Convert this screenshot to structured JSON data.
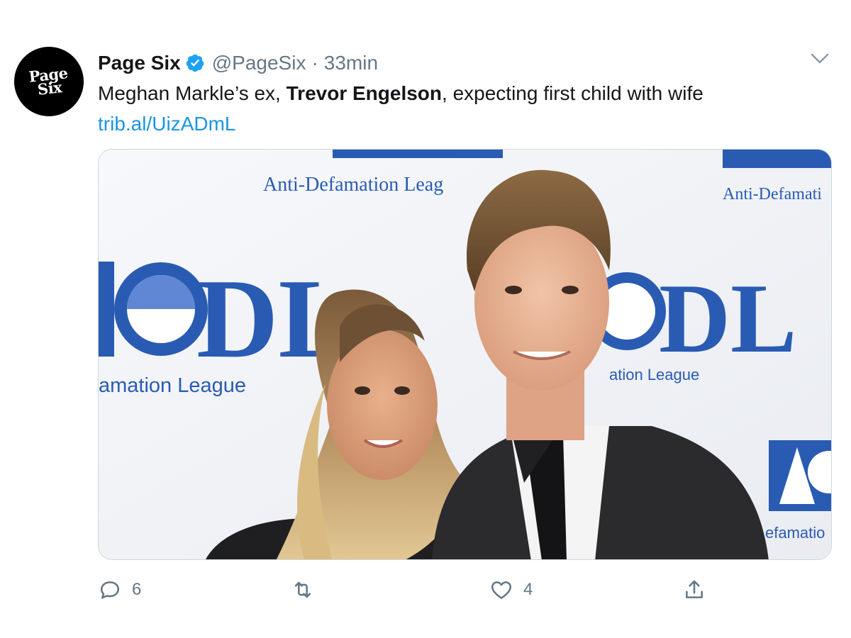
{
  "tweet": {
    "avatar": {
      "line1": "Page",
      "line2": "Six",
      "bg_color": "#000000"
    },
    "display_name": "Page Six",
    "verified_icon": "verified-badge-icon",
    "handle": "@PageSix",
    "separator": "·",
    "time": "33min",
    "text_before": "Meghan Markle’s ex, ",
    "text_bold": "Trevor Engelson",
    "text_after": ", expecting first child with wife",
    "link": "trib.al/UizADmL",
    "accent_color": "#1b95e0"
  },
  "media": {
    "backdrop_texts": {
      "top_center": "Anti-Defamation Leag",
      "top_right": "Anti-Defamati",
      "mid_left_logo": "DL",
      "mid_left_caption": "amation League",
      "mid_right_logo": "DL",
      "mid_right_caption": "ation League",
      "bottom_right_caption": "efamatio"
    },
    "brand_color": "#2a5bb3"
  },
  "actions": {
    "reply_count": "6",
    "retweet_count": "",
    "like_count": "4",
    "icons": [
      "reply-icon",
      "retweet-icon",
      "like-icon",
      "share-icon"
    ]
  }
}
